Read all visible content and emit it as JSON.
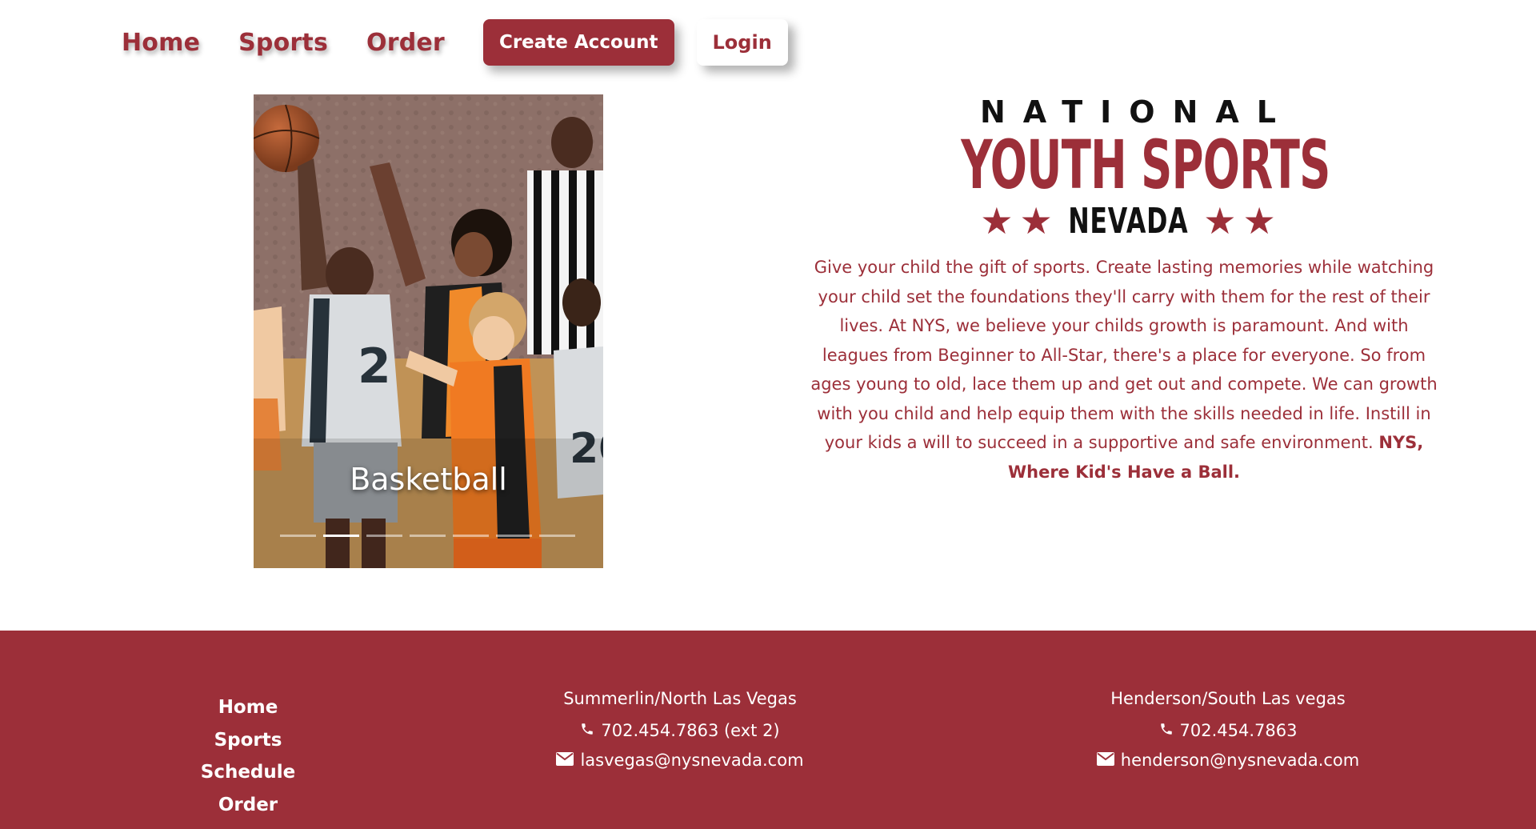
{
  "nav": {
    "home": "Home",
    "sports": "Sports",
    "order": "Order",
    "create_account": "Create Account",
    "login": "Login"
  },
  "carousel": {
    "caption": "Basketball",
    "slide_count": 7,
    "active_index": 1
  },
  "logo": {
    "line1": "NATIONAL",
    "line2": "YOUTH SPORTS",
    "line3": "NEVADA"
  },
  "blurb": {
    "text": "Give your child the gift of sports. Create lasting memories while watching your child set the foundations they'll carry with them for the rest of their lives. At NYS, we believe your childs growth is paramount. And with leagues from Beginner to All-Star, there's a place for everyone. So from ages young to old, lace them up and get out and compete. We can growth with you child and help equip them with the skills needed in life. Instill in your kids a will to succeed in a supportive and safe environment.",
    "tagline": "NYS, Where Kid's Have a Ball."
  },
  "footer": {
    "links": [
      "Home",
      "Sports",
      "Schedule",
      "Order"
    ],
    "locations": [
      {
        "title": "Summerlin/North Las Vegas",
        "phone": "702.454.7863 (ext 2)",
        "email": "lasvegas@nysnevada.com"
      },
      {
        "title": "Henderson/South Las vegas",
        "phone": "702.454.7863",
        "email": "henderson@nysnevada.com"
      }
    ]
  },
  "colors": {
    "brand": "#9c2f39",
    "footer_bg": "#9c2f39",
    "text_on_brand": "#ffffff"
  },
  "icons": {
    "phone": "phone-icon",
    "email": "envelope-icon",
    "star": "star-icon"
  }
}
